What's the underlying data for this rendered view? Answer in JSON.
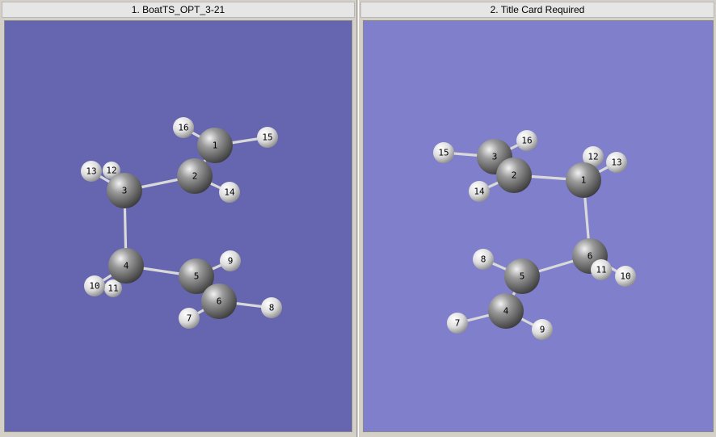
{
  "panes": [
    {
      "title": "1.  BoatTS_OPT_3-21",
      "background": "#6565b0",
      "atoms": [
        {
          "n": "12",
          "t": "H"
        },
        {
          "n": "16",
          "t": "H"
        },
        {
          "n": "1",
          "t": "C"
        },
        {
          "n": "15",
          "t": "H"
        },
        {
          "n": "13",
          "t": "H"
        },
        {
          "n": "2",
          "t": "C"
        },
        {
          "n": "14",
          "t": "H"
        },
        {
          "n": "3",
          "t": "C"
        },
        {
          "n": "9",
          "t": "H"
        },
        {
          "n": "11",
          "t": "H"
        },
        {
          "n": "10",
          "t": "H"
        },
        {
          "n": "4",
          "t": "C"
        },
        {
          "n": "5",
          "t": "C"
        },
        {
          "n": "6",
          "t": "C"
        },
        {
          "n": "7",
          "t": "H"
        },
        {
          "n": "8",
          "t": "H"
        }
      ]
    },
    {
      "title": "2.  Title Card Required",
      "background": "#7f7fcb",
      "atoms": [
        {
          "n": "16",
          "t": "H"
        },
        {
          "n": "3",
          "t": "C"
        },
        {
          "n": "15",
          "t": "H"
        },
        {
          "n": "2",
          "t": "C"
        },
        {
          "n": "14",
          "t": "H"
        },
        {
          "n": "12",
          "t": "H"
        },
        {
          "n": "13",
          "t": "H"
        },
        {
          "n": "1",
          "t": "C"
        },
        {
          "n": "8",
          "t": "H"
        },
        {
          "n": "6",
          "t": "C"
        },
        {
          "n": "5",
          "t": "C"
        },
        {
          "n": "10",
          "t": "H"
        },
        {
          "n": "11",
          "t": "H"
        },
        {
          "n": "7",
          "t": "H"
        },
        {
          "n": "4",
          "t": "C"
        },
        {
          "n": "9",
          "t": "H"
        }
      ]
    }
  ]
}
